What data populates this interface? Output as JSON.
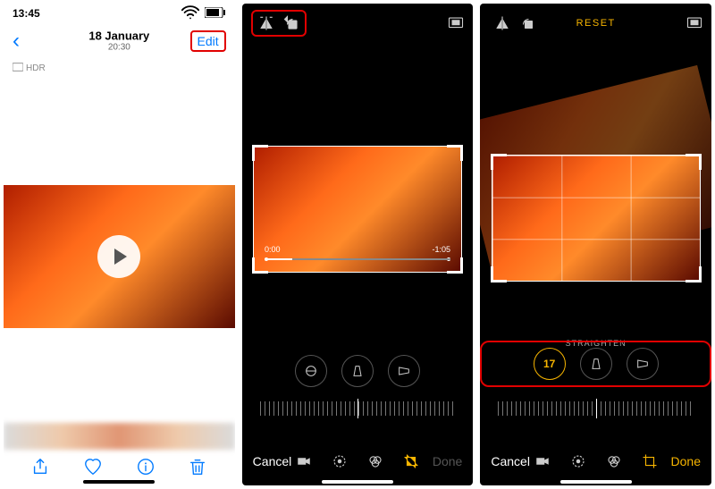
{
  "screen1": {
    "status": {
      "time": "13:45",
      "wifi_icon": "wifi-icon",
      "battery_icon": "battery-icon"
    },
    "nav": {
      "back_icon": "‹",
      "date": "18 January",
      "time": "20:30",
      "edit": "Edit"
    },
    "hdr": {
      "icon": "hdr-icon",
      "label": "HDR"
    },
    "play_icon": "play-icon",
    "toolbar": {
      "share_icon": "share-icon",
      "heart_icon": "heart-icon",
      "info_icon": "info-icon",
      "trash_icon": "trash-icon"
    }
  },
  "screen2": {
    "top": {
      "flip_icon": "flip-horizontal-icon",
      "rotate_icon": "rotate-icon",
      "aspect_icon": "aspect-ratio-icon"
    },
    "trim": {
      "start": "0:00",
      "end": "-1:05"
    },
    "adjust": {
      "buttons": [
        "straighten-icon",
        "vertical-icon",
        "horizontal-icon"
      ]
    },
    "bottom": {
      "cancel": "Cancel",
      "done": "Done",
      "icons": [
        "video-icon",
        "adjust-dial-icon",
        "filters-icon",
        "crop-icon"
      ]
    }
  },
  "screen3": {
    "top": {
      "flip_icon": "flip-horizontal-icon",
      "rotate_icon": "rotate-icon",
      "reset": "RESET",
      "aspect_icon": "aspect-ratio-icon"
    },
    "straighten_label": "STRAIGHTEN",
    "adjust": {
      "value": "17",
      "buttons": [
        "straighten-icon",
        "vertical-icon",
        "horizontal-icon"
      ]
    },
    "bottom": {
      "cancel": "Cancel",
      "done": "Done",
      "icons": [
        "video-icon",
        "adjust-dial-icon",
        "filters-icon",
        "crop-icon"
      ]
    }
  }
}
